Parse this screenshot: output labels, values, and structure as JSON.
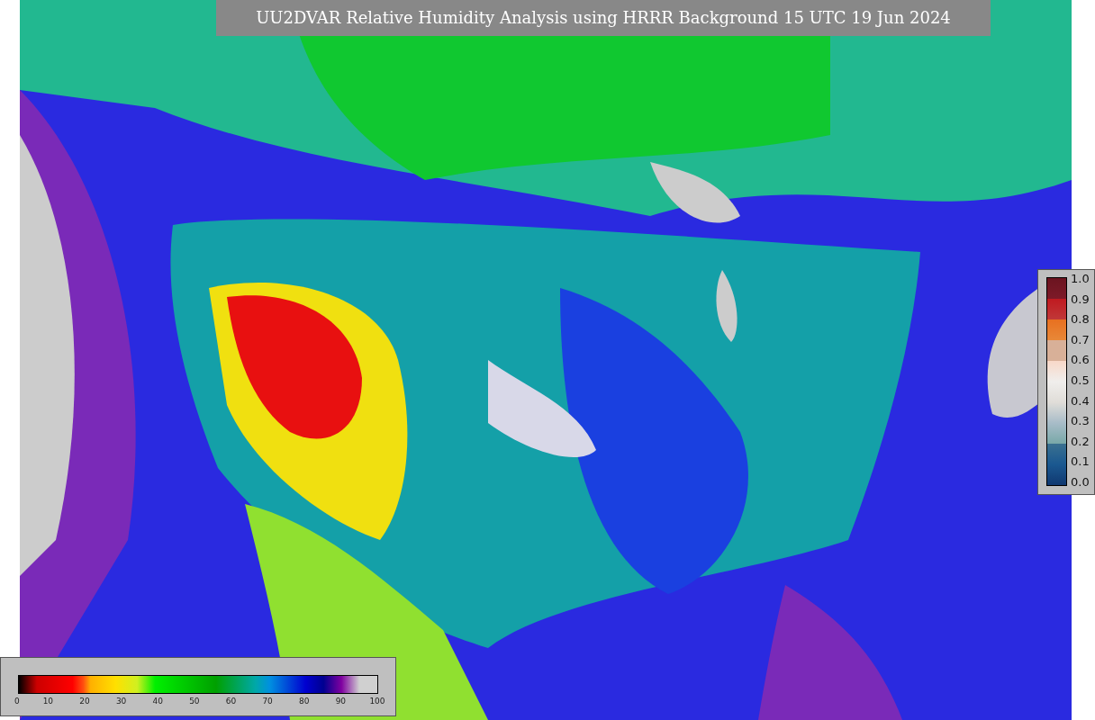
{
  "title": "UU2DVAR Relative Humidity Analysis using HRRR Background 15 UTC 19 Jun 2024",
  "side_legend": {
    "labels": [
      "1.0",
      "0.9",
      "0.8",
      "0.7",
      "0.6",
      "0.5",
      "0.4",
      "0.3",
      "0.2",
      "0.1",
      "0.0"
    ]
  },
  "bottom_legend": {
    "ticks": [
      "0",
      "10",
      "20",
      "30",
      "40",
      "50",
      "60",
      "70",
      "80",
      "90",
      "100"
    ]
  }
}
